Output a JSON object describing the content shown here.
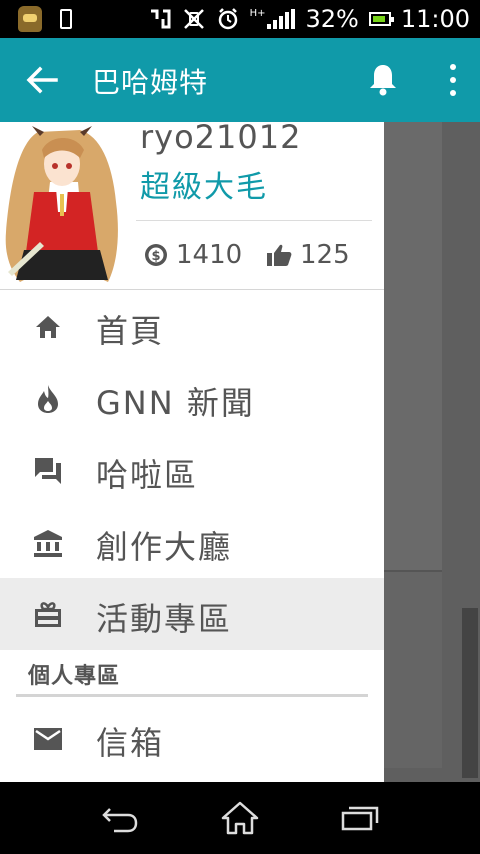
{
  "status_bar": {
    "battery_percent": "32%",
    "time": "11:00",
    "network_label": "H+"
  },
  "app_bar": {
    "title": "巴哈姆特"
  },
  "drawer": {
    "profile": {
      "username": "ryo21012",
      "rank": "超級大毛",
      "coins": "1410",
      "gp": "125"
    },
    "menu_items": [
      {
        "label": "首頁",
        "icon": "home-icon"
      },
      {
        "label": "GNN 新聞",
        "icon": "flame-icon"
      },
      {
        "label": "哈啦區",
        "icon": "forum-icon"
      },
      {
        "label": "創作大廳",
        "icon": "bank-icon"
      },
      {
        "label": "活動專區",
        "icon": "gift-card-icon",
        "selected": true
      }
    ],
    "section_title": "個人專區",
    "personal_items": [
      {
        "label": "信箱",
        "icon": "mail-icon"
      }
    ]
  },
  "colors": {
    "accent": "#109aa9",
    "drawer_bg": "#ffffff",
    "selected_bg": "#ececec",
    "text": "#555555",
    "scrim": "#5f5f5f"
  }
}
